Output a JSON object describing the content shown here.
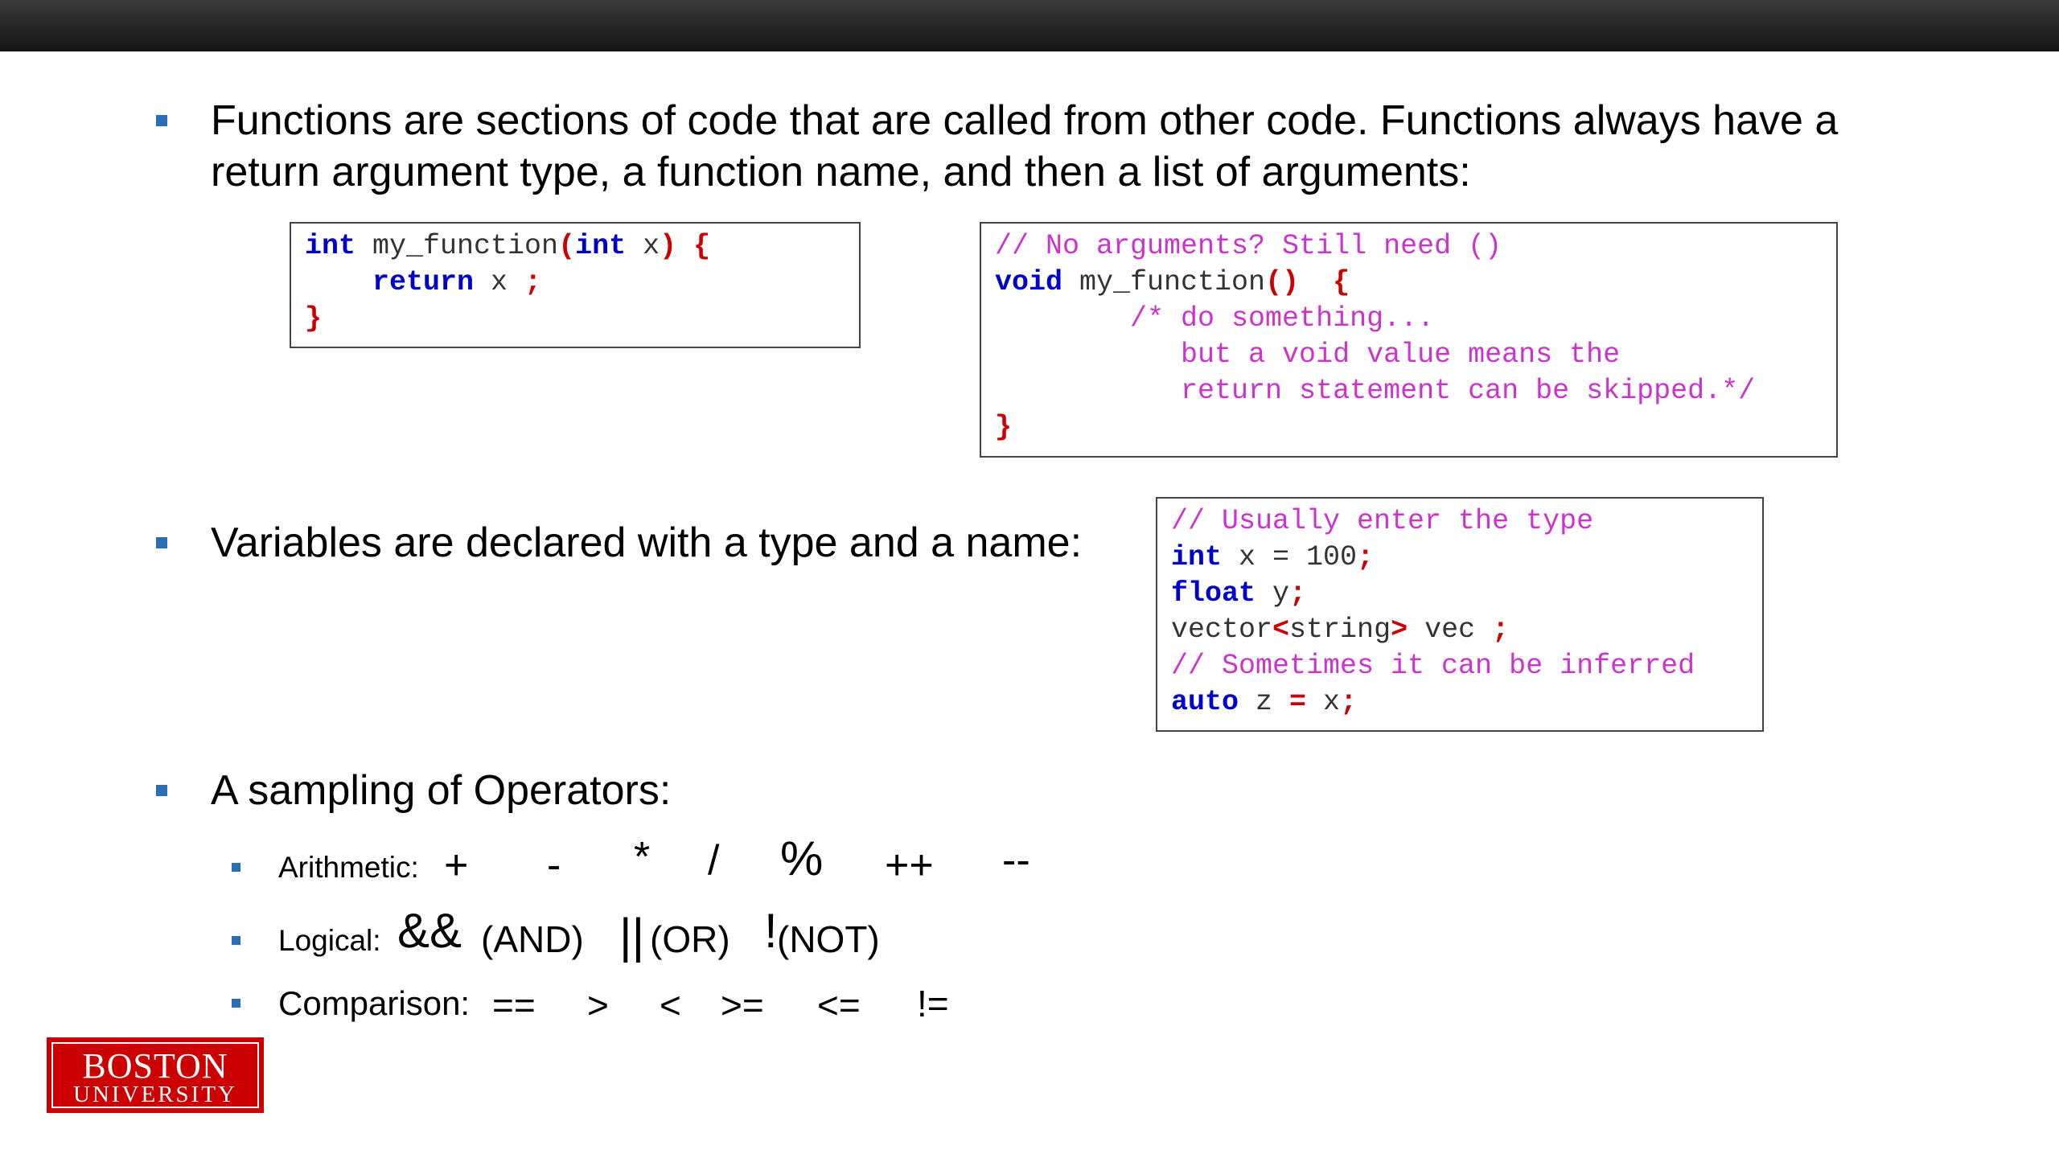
{
  "bullets": {
    "functions": {
      "line1": "Functions are sections of code that are called from other code.  Functions always have a",
      "line2": "return argument type, a function name, and then a list of arguments:"
    },
    "variables": "Variables are declared with a type and a name:",
    "operators": "A sampling of Operators:"
  },
  "code": {
    "function_example": [
      [
        {
          "t": "int",
          "c": "kw"
        },
        {
          "t": " my_function",
          "c": "id"
        },
        {
          "t": "(",
          "c": "rd"
        },
        {
          "t": "int",
          "c": "kw"
        },
        {
          "t": " x",
          "c": "id"
        },
        {
          "t": ")",
          "c": "rd"
        },
        {
          "t": " {",
          "c": "rd"
        }
      ],
      [
        {
          "t": "    ",
          "c": "id"
        },
        {
          "t": "return",
          "c": "kw"
        },
        {
          "t": " x ",
          "c": "id"
        },
        {
          "t": ";",
          "c": "rd"
        }
      ],
      [
        {
          "t": "}",
          "c": "rd"
        }
      ]
    ],
    "void_example": [
      [
        {
          "t": "// No arguments? Still need ()",
          "c": "cm"
        }
      ],
      [
        {
          "t": "void",
          "c": "kw"
        },
        {
          "t": " my_function",
          "c": "id"
        },
        {
          "t": "()",
          "c": "rd"
        },
        {
          "t": "  {",
          "c": "rd"
        }
      ],
      [
        {
          "t": "        /* do something...",
          "c": "cm"
        }
      ],
      [
        {
          "t": "           but a void value means the",
          "c": "cm"
        }
      ],
      [
        {
          "t": "           return statement can be skipped.*/",
          "c": "cm"
        }
      ],
      [
        {
          "t": "}",
          "c": "rd"
        }
      ]
    ],
    "variables_example": [
      [
        {
          "t": "// Usually enter the type",
          "c": "cm"
        }
      ],
      [
        {
          "t": "int",
          "c": "kw"
        },
        {
          "t": " x = 100",
          "c": "id"
        },
        {
          "t": ";",
          "c": "rd"
        }
      ],
      [
        {
          "t": "float",
          "c": "kw"
        },
        {
          "t": " y",
          "c": "id"
        },
        {
          "t": ";",
          "c": "rd"
        }
      ],
      [
        {
          "t": "vector",
          "c": "id"
        },
        {
          "t": "<",
          "c": "rd"
        },
        {
          "t": "string",
          "c": "id"
        },
        {
          "t": ">",
          "c": "rd"
        },
        {
          "t": " vec ",
          "c": "id"
        },
        {
          "t": ";",
          "c": "rd"
        }
      ],
      [
        {
          "t": "// Sometimes it can be inferred",
          "c": "cm"
        }
      ],
      [
        {
          "t": "auto",
          "c": "kw"
        },
        {
          "t": " z ",
          "c": "id"
        },
        {
          "t": "=",
          "c": "rd"
        },
        {
          "t": " x",
          "c": "id"
        },
        {
          "t": ";",
          "c": "rd"
        }
      ]
    ]
  },
  "operators": {
    "arithmetic": {
      "label": "Arithmetic:",
      "ops": [
        "+",
        "-",
        "*",
        "/",
        "%",
        "++",
        "--"
      ]
    },
    "logical": {
      "label": "Logical:",
      "and_symbol": "&&",
      "and_text": "(AND)",
      "or_symbol": "||",
      "or_text": "(OR)",
      "not_symbol": "!",
      "not_text": "(NOT)"
    },
    "comparison": {
      "label": "Comparison:",
      "ops": [
        "==",
        ">",
        "<",
        ">=",
        "<=",
        "!="
      ]
    }
  },
  "logo": {
    "line1": "BOSTON",
    "line2": "UNIVERSITY"
  },
  "colors": {
    "bullet": "#2a6fb5",
    "keyword": "#0000cc",
    "comment": "#cc33cc",
    "punctuation": "#cc0000",
    "logo_red": "#cc0000"
  }
}
